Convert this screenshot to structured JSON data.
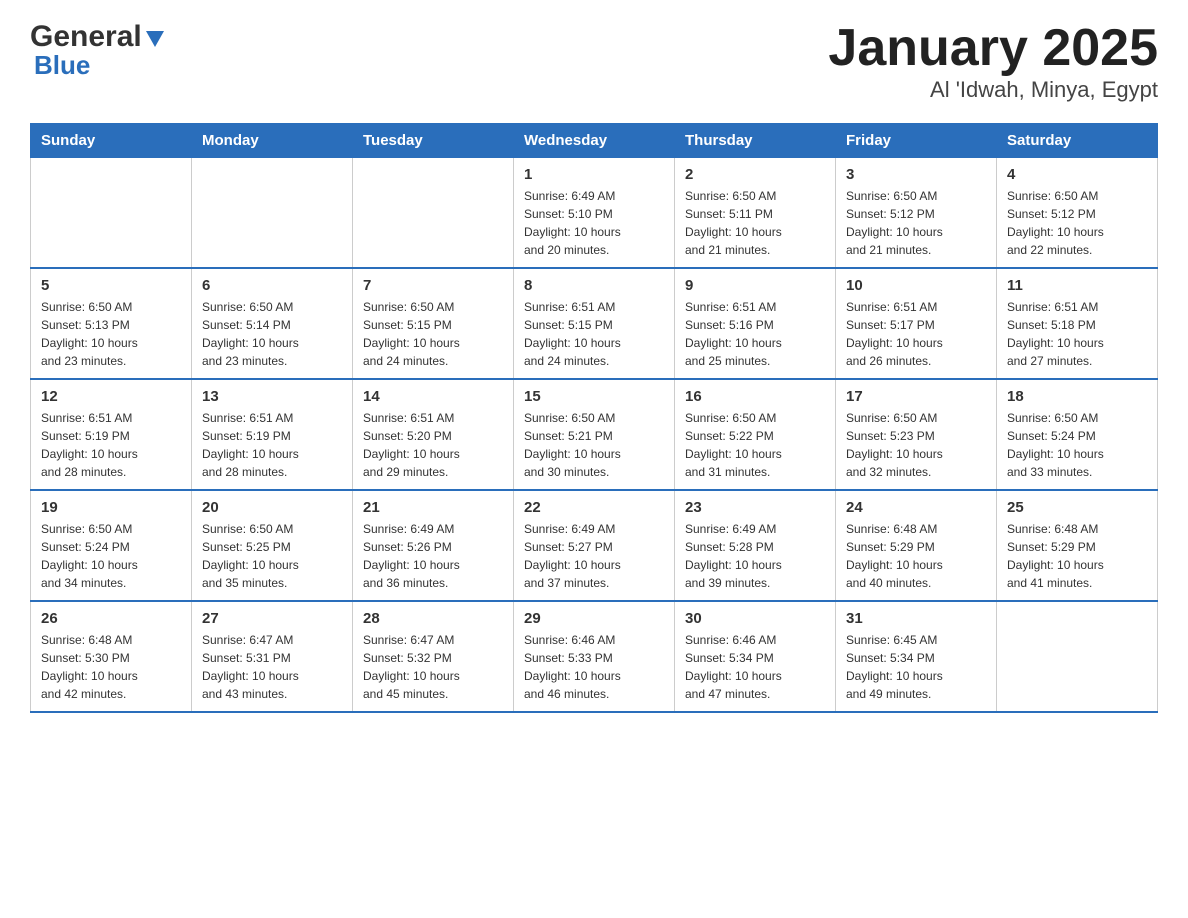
{
  "header": {
    "logo_general": "General",
    "logo_blue": "Blue",
    "title": "January 2025",
    "subtitle": "Al 'Idwah, Minya, Egypt"
  },
  "days_of_week": [
    "Sunday",
    "Monday",
    "Tuesday",
    "Wednesday",
    "Thursday",
    "Friday",
    "Saturday"
  ],
  "weeks": [
    [
      {
        "num": "",
        "info": ""
      },
      {
        "num": "",
        "info": ""
      },
      {
        "num": "",
        "info": ""
      },
      {
        "num": "1",
        "info": "Sunrise: 6:49 AM\nSunset: 5:10 PM\nDaylight: 10 hours\nand 20 minutes."
      },
      {
        "num": "2",
        "info": "Sunrise: 6:50 AM\nSunset: 5:11 PM\nDaylight: 10 hours\nand 21 minutes."
      },
      {
        "num": "3",
        "info": "Sunrise: 6:50 AM\nSunset: 5:12 PM\nDaylight: 10 hours\nand 21 minutes."
      },
      {
        "num": "4",
        "info": "Sunrise: 6:50 AM\nSunset: 5:12 PM\nDaylight: 10 hours\nand 22 minutes."
      }
    ],
    [
      {
        "num": "5",
        "info": "Sunrise: 6:50 AM\nSunset: 5:13 PM\nDaylight: 10 hours\nand 23 minutes."
      },
      {
        "num": "6",
        "info": "Sunrise: 6:50 AM\nSunset: 5:14 PM\nDaylight: 10 hours\nand 23 minutes."
      },
      {
        "num": "7",
        "info": "Sunrise: 6:50 AM\nSunset: 5:15 PM\nDaylight: 10 hours\nand 24 minutes."
      },
      {
        "num": "8",
        "info": "Sunrise: 6:51 AM\nSunset: 5:15 PM\nDaylight: 10 hours\nand 24 minutes."
      },
      {
        "num": "9",
        "info": "Sunrise: 6:51 AM\nSunset: 5:16 PM\nDaylight: 10 hours\nand 25 minutes."
      },
      {
        "num": "10",
        "info": "Sunrise: 6:51 AM\nSunset: 5:17 PM\nDaylight: 10 hours\nand 26 minutes."
      },
      {
        "num": "11",
        "info": "Sunrise: 6:51 AM\nSunset: 5:18 PM\nDaylight: 10 hours\nand 27 minutes."
      }
    ],
    [
      {
        "num": "12",
        "info": "Sunrise: 6:51 AM\nSunset: 5:19 PM\nDaylight: 10 hours\nand 28 minutes."
      },
      {
        "num": "13",
        "info": "Sunrise: 6:51 AM\nSunset: 5:19 PM\nDaylight: 10 hours\nand 28 minutes."
      },
      {
        "num": "14",
        "info": "Sunrise: 6:51 AM\nSunset: 5:20 PM\nDaylight: 10 hours\nand 29 minutes."
      },
      {
        "num": "15",
        "info": "Sunrise: 6:50 AM\nSunset: 5:21 PM\nDaylight: 10 hours\nand 30 minutes."
      },
      {
        "num": "16",
        "info": "Sunrise: 6:50 AM\nSunset: 5:22 PM\nDaylight: 10 hours\nand 31 minutes."
      },
      {
        "num": "17",
        "info": "Sunrise: 6:50 AM\nSunset: 5:23 PM\nDaylight: 10 hours\nand 32 minutes."
      },
      {
        "num": "18",
        "info": "Sunrise: 6:50 AM\nSunset: 5:24 PM\nDaylight: 10 hours\nand 33 minutes."
      }
    ],
    [
      {
        "num": "19",
        "info": "Sunrise: 6:50 AM\nSunset: 5:24 PM\nDaylight: 10 hours\nand 34 minutes."
      },
      {
        "num": "20",
        "info": "Sunrise: 6:50 AM\nSunset: 5:25 PM\nDaylight: 10 hours\nand 35 minutes."
      },
      {
        "num": "21",
        "info": "Sunrise: 6:49 AM\nSunset: 5:26 PM\nDaylight: 10 hours\nand 36 minutes."
      },
      {
        "num": "22",
        "info": "Sunrise: 6:49 AM\nSunset: 5:27 PM\nDaylight: 10 hours\nand 37 minutes."
      },
      {
        "num": "23",
        "info": "Sunrise: 6:49 AM\nSunset: 5:28 PM\nDaylight: 10 hours\nand 39 minutes."
      },
      {
        "num": "24",
        "info": "Sunrise: 6:48 AM\nSunset: 5:29 PM\nDaylight: 10 hours\nand 40 minutes."
      },
      {
        "num": "25",
        "info": "Sunrise: 6:48 AM\nSunset: 5:29 PM\nDaylight: 10 hours\nand 41 minutes."
      }
    ],
    [
      {
        "num": "26",
        "info": "Sunrise: 6:48 AM\nSunset: 5:30 PM\nDaylight: 10 hours\nand 42 minutes."
      },
      {
        "num": "27",
        "info": "Sunrise: 6:47 AM\nSunset: 5:31 PM\nDaylight: 10 hours\nand 43 minutes."
      },
      {
        "num": "28",
        "info": "Sunrise: 6:47 AM\nSunset: 5:32 PM\nDaylight: 10 hours\nand 45 minutes."
      },
      {
        "num": "29",
        "info": "Sunrise: 6:46 AM\nSunset: 5:33 PM\nDaylight: 10 hours\nand 46 minutes."
      },
      {
        "num": "30",
        "info": "Sunrise: 6:46 AM\nSunset: 5:34 PM\nDaylight: 10 hours\nand 47 minutes."
      },
      {
        "num": "31",
        "info": "Sunrise: 6:45 AM\nSunset: 5:34 PM\nDaylight: 10 hours\nand 49 minutes."
      },
      {
        "num": "",
        "info": ""
      }
    ]
  ]
}
